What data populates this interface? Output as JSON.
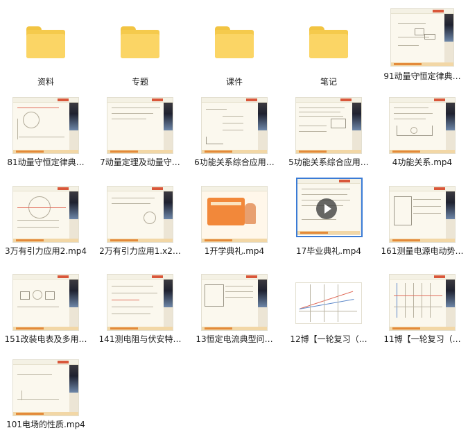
{
  "items": [
    {
      "name": "资料",
      "type": "folder"
    },
    {
      "name": "专题",
      "type": "folder"
    },
    {
      "name": "课件",
      "type": "folder"
    },
    {
      "name": "笔记",
      "type": "folder"
    },
    {
      "name": "91动量守恒定律典…",
      "type": "video"
    },
    {
      "name": "81动量守恒定律典…",
      "type": "video"
    },
    {
      "name": "7动量定理及动量守…",
      "type": "video"
    },
    {
      "name": "6功能关系综合应用…",
      "type": "video"
    },
    {
      "name": "5功能关系综合应用…",
      "type": "video"
    },
    {
      "name": "4功能关系.mp4",
      "type": "video"
    },
    {
      "name": "3万有引力应用2.mp4",
      "type": "video"
    },
    {
      "name": "2万有引力应用1.x2…",
      "type": "video"
    },
    {
      "name": "1开学典礼.mp4",
      "type": "video"
    },
    {
      "name": "17毕业典礼.mp4",
      "type": "video",
      "selected": true
    },
    {
      "name": "161测量电源电动势…",
      "type": "video"
    },
    {
      "name": "151改装电表及多用…",
      "type": "video"
    },
    {
      "name": "141测电阻与伏安特…",
      "type": "video"
    },
    {
      "name": "13恒定电流典型问…",
      "type": "video"
    },
    {
      "name": "12博【一轮复习（…",
      "type": "video"
    },
    {
      "name": "11博【一轮复习（…",
      "type": "video"
    },
    {
      "name": "101电场的性质.mp4",
      "type": "video"
    }
  ]
}
